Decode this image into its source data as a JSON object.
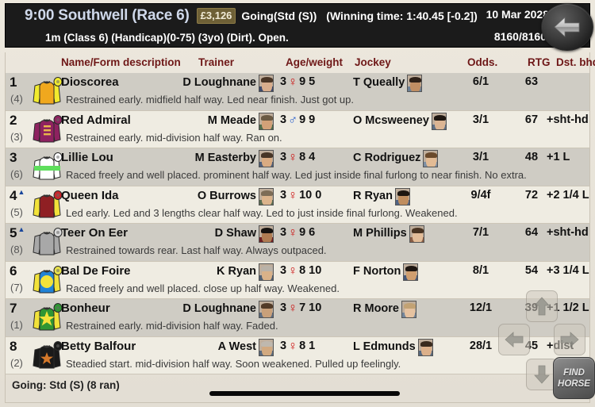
{
  "header": {
    "race_title": "9:00 Southwell (Race 6)",
    "prize": "£3,126",
    "going": "Going(Std (S))",
    "winning_time": "(Winning time: 1:40.45 [-0.2])",
    "date": "10 Mar 2028",
    "conditions": "1m (Class 6) (Handicap)(0-75) (3yo) (Dirt). Open.",
    "race_id": "8160/8160",
    "back_icon": "back-arrow-icon"
  },
  "columns": {
    "name": "Name/Form description",
    "trainer": "Trainer",
    "age_weight": "Age/weight",
    "jockey": "Jockey",
    "odds": "Odds.",
    "rtg": "RTG",
    "dst": "Dst. bhd."
  },
  "runners": [
    {
      "place": "1",
      "triangle": "",
      "draw": "(4)",
      "horse": "Dioscorea",
      "comment": "Restrained early. midfield half way. Led near finish. Just got up.",
      "trainer": "D Loughnane",
      "age": "3",
      "sex": "♀",
      "sex_type": "f",
      "weight": "9 5",
      "jockey": "T Queally",
      "odds": "6/1",
      "rtg": "63",
      "dst": "",
      "silk": {
        "body": "#f0a81e",
        "sleeve": "#f2eb2e",
        "cap": "#f2eb2e",
        "pattern": "plain"
      },
      "trainer_face": {
        "skin": "#d8ad8c",
        "hair": "#4a3626",
        "shirt": "#3d4a6b"
      },
      "jockey_face": {
        "skin": "#c08e63",
        "hair": "#2e2118",
        "shirt": "#6b7f96"
      }
    },
    {
      "place": "2",
      "triangle": "",
      "draw": "(3)",
      "horse": "Red Admiral",
      "comment": "Restrained early. mid-division half way. Ran on.",
      "trainer": "M Meade",
      "age": "3",
      "sex": "♂",
      "sex_type": "m",
      "weight": "9 9",
      "jockey": "O Mcsweeney",
      "odds": "3/1",
      "rtg": "67",
      "dst": "+sht-hd",
      "silk": {
        "body": "#8e2260",
        "sleeve": "#8e2260",
        "cap": "#8e2260",
        "pattern": "bars"
      },
      "trainer_face": {
        "skin": "#d2a178",
        "hair": "#6b5a42",
        "shirt": "#4e6b4a"
      },
      "jockey_face": {
        "skin": "#dcb593",
        "hair": "#201812",
        "shirt": "#5d6f85"
      }
    },
    {
      "place": "3",
      "triangle": "",
      "draw": "(6)",
      "horse": "Lillie Lou",
      "comment": "Raced freely and well placed. prominent half way. Led just inside final furlong to near finish. No extra.",
      "trainer": "M Easterby",
      "age": "3",
      "sex": "♀",
      "sex_type": "f",
      "weight": "8 4",
      "jockey": "C Rodriguez",
      "odds": "3/1",
      "rtg": "48",
      "dst": "+1  L",
      "silk": {
        "body": "#ffffff",
        "sleeve": "#ffffff",
        "cap": "#ffffff",
        "pattern": "sash-green"
      },
      "trainer_face": {
        "skin": "#d9ab82",
        "hair": "#473526",
        "shirt": "#4f5f7a"
      },
      "jockey_face": {
        "skin": "#e2bb95",
        "hair": "#6a4a2c",
        "shirt": "#7c8ea3"
      }
    },
    {
      "place": "4",
      "triangle": "▲",
      "draw": "(5)",
      "horse": "Queen Ida",
      "comment": "Led early. Led and 3 lengths clear half way. Led to just inside final furlong. Weakened.",
      "trainer": "O Burrows",
      "age": "3",
      "sex": "♀",
      "sex_type": "f",
      "weight": "10 0",
      "jockey": "R Ryan",
      "odds": "9/4f",
      "rtg": "72",
      "dst": "+2 1/4 L",
      "silk": {
        "body": "#8f1f23",
        "sleeve": "#f2e23a",
        "cap": "#c9262b",
        "pattern": "plain"
      },
      "trainer_face": {
        "skin": "#dcb48c",
        "hair": "#7d6c56",
        "shirt": "#5a6d52"
      },
      "jockey_face": {
        "skin": "#c08e5f",
        "hair": "#1d1610",
        "shirt": "#4f6383"
      }
    },
    {
      "place": "5",
      "triangle": "▲",
      "draw": "(8)",
      "horse": "Teer On Eer",
      "comment": "Restrained towards rear. Last half way. Always outpaced.",
      "trainer": "D Shaw",
      "age": "3",
      "sex": "♀",
      "sex_type": "f",
      "weight": "9 6",
      "jockey": "M Phillips",
      "odds": "7/1",
      "rtg": "64",
      "dst": "+sht-hd",
      "silk": {
        "body": "#a8a8a8",
        "sleeve": "#a8a8a8",
        "cap": "#d8d8d8",
        "pattern": "plain"
      },
      "trainer_face": {
        "skin": "#b07c52",
        "hair": "#171310",
        "shirt": "#6d1f22"
      },
      "jockey_face": {
        "skin": "#e3bd99",
        "hair": "#4a3422",
        "shirt": "#8a5e46"
      }
    },
    {
      "place": "6",
      "triangle": "",
      "draw": "(7)",
      "horse": "Bal De Foire",
      "comment": "Raced freely and well placed. close up half way. Weakened.",
      "trainer": "K Ryan",
      "age": "3",
      "sex": "♀",
      "sex_type": "f",
      "weight": "8 10",
      "jockey": "F Norton",
      "odds": "8/1",
      "rtg": "54",
      "dst": "+3 1/4 L",
      "silk": {
        "body": "#2183d6",
        "sleeve": "#f2e23a",
        "cap": "#e9e24a",
        "pattern": "disc-yellow"
      },
      "trainer_face": {
        "skin": "#d9b289",
        "hair": "#b9b2a8",
        "shirt": "#4f5f72"
      },
      "jockey_face": {
        "skin": "#cf9e6f",
        "hair": "#1e1611",
        "shirt": "#42577a"
      }
    },
    {
      "place": "7",
      "triangle": "",
      "draw": "(1)",
      "horse": "Bonheur",
      "comment": "Restrained early. mid-division half way. Faded.",
      "trainer": "D Loughnane",
      "age": "3",
      "sex": "♀",
      "sex_type": "f",
      "weight": "7 10",
      "jockey": "R Moore",
      "odds": "12/1",
      "rtg": "39",
      "dst": "+1 1/2 L",
      "silk": {
        "body": "#2f9633",
        "sleeve": "#f2e23a",
        "cap": "#2f9633",
        "pattern": "star-yellow"
      },
      "trainer_face": {
        "skin": "#c9a07a",
        "hair": "#523b28",
        "shirt": "#5c6b80"
      },
      "jockey_face": {
        "skin": "#e6c2a0",
        "hair": "#c2a274",
        "shirt": "#74869b"
      }
    },
    {
      "place": "8",
      "triangle": "",
      "draw": "(2)",
      "horse": "Betty Balfour",
      "comment": "Steadied start. mid-division half way. Soon weakened. Pulled up feelingly.",
      "trainer": "A West",
      "age": "3",
      "sex": "♀",
      "sex_type": "f",
      "weight": "8 1",
      "jockey": "L Edmunds",
      "odds": "28/1",
      "rtg": "45",
      "dst": "+dist",
      "silk": {
        "body": "#1a1a1a",
        "sleeve": "#1a1a1a",
        "cap": "#1a1a1a",
        "pattern": "star-orange"
      },
      "trainer_face": {
        "skin": "#d2a97f",
        "hair": "#bfb8ae",
        "shirt": "#5a6a7e"
      },
      "jockey_face": {
        "skin": "#dcb08a",
        "hair": "#3a2b1e",
        "shirt": "#56687f"
      }
    }
  ],
  "footer": {
    "going_summary": "Going: Std (S)  (8 ran)",
    "scrollbar": "horizontal-scrollbar"
  },
  "controls": {
    "up": "scroll-up",
    "down": "scroll-down",
    "left": "previous-race",
    "right": "next-race",
    "find_horse_line1": "FIND",
    "find_horse_line2": "HORSE"
  }
}
